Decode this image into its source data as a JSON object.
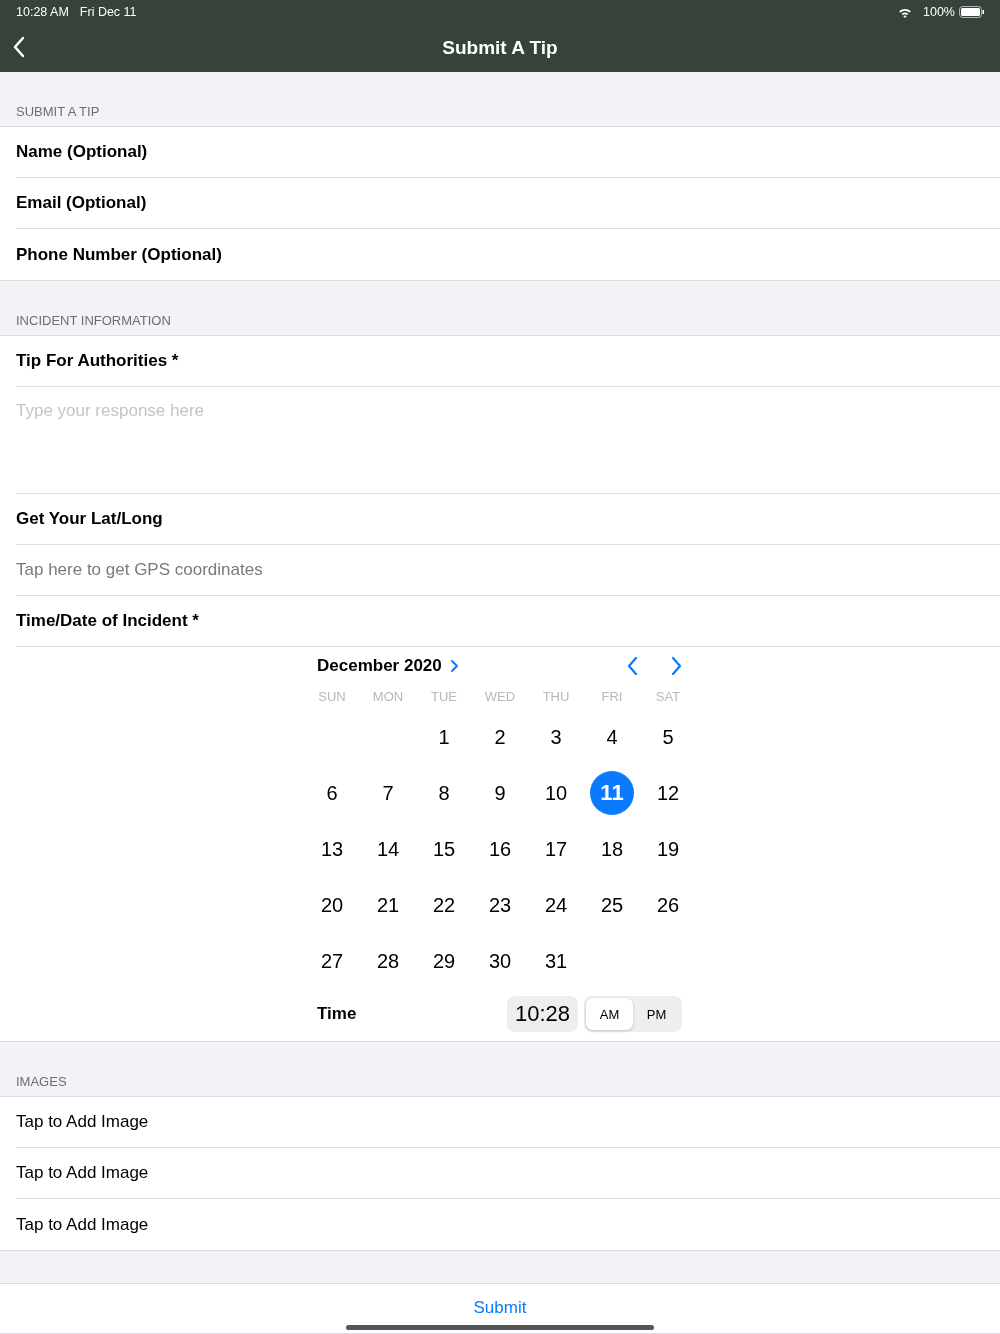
{
  "status_bar": {
    "time": "10:28 AM",
    "date": "Fri Dec 11",
    "battery": "100%"
  },
  "nav": {
    "title": "Submit A Tip"
  },
  "sections": [
    {
      "header": "SUBMIT A TIP",
      "items": [
        {
          "kind": "label",
          "text": "Name (Optional)"
        },
        {
          "kind": "label",
          "text": "Email (Optional)"
        },
        {
          "kind": "label",
          "text": "Phone Number (Optional)"
        }
      ]
    },
    {
      "header": "INCIDENT INFORMATION",
      "items": [
        {
          "kind": "label",
          "text": "Tip For Authorities *"
        },
        {
          "kind": "textarea",
          "placeholder": "Type your response here"
        },
        {
          "kind": "label",
          "text": "Get Your Lat/Long"
        },
        {
          "kind": "action",
          "text": "Tap here to get GPS coordinates"
        },
        {
          "kind": "label",
          "text": "Time/Date of Incident *"
        },
        {
          "kind": "datepicker",
          "month": "December 2020",
          "weekdays": [
            "SUN",
            "MON",
            "TUE",
            "WED",
            "THU",
            "FRI",
            "SAT"
          ],
          "weeks": [
            {
              "days": [
                {
                  "kind": "blank"
                },
                {
                  "kind": "blank"
                },
                {
                  "day": "1",
                  "selected": false
                },
                {
                  "day": "2",
                  "selected": false
                },
                {
                  "day": "3",
                  "selected": false
                },
                {
                  "day": "4",
                  "selected": false
                },
                {
                  "day": "5",
                  "selected": false
                }
              ]
            },
            {
              "days": [
                {
                  "day": "6",
                  "selected": false
                },
                {
                  "day": "7",
                  "selected": false
                },
                {
                  "day": "8",
                  "selected": false
                },
                {
                  "day": "9",
                  "selected": false
                },
                {
                  "day": "10",
                  "selected": false
                },
                {
                  "day": "11",
                  "selected": true
                },
                {
                  "day": "12",
                  "selected": false
                }
              ]
            },
            {
              "days": [
                {
                  "day": "13",
                  "selected": false
                },
                {
                  "day": "14",
                  "selected": false
                },
                {
                  "day": "15",
                  "selected": false
                },
                {
                  "day": "16",
                  "selected": false
                },
                {
                  "day": "17",
                  "selected": false
                },
                {
                  "day": "18",
                  "selected": false
                },
                {
                  "day": "19",
                  "selected": false
                }
              ]
            },
            {
              "days": [
                {
                  "day": "20",
                  "selected": false
                },
                {
                  "day": "21",
                  "selected": false
                },
                {
                  "day": "22",
                  "selected": false
                },
                {
                  "day": "23",
                  "selected": false
                },
                {
                  "day": "24",
                  "selected": false
                },
                {
                  "day": "25",
                  "selected": false
                },
                {
                  "day": "26",
                  "selected": false
                }
              ]
            },
            {
              "days": [
                {
                  "day": "27",
                  "selected": false
                },
                {
                  "day": "28",
                  "selected": false
                },
                {
                  "day": "29",
                  "selected": false
                },
                {
                  "day": "30",
                  "selected": false
                },
                {
                  "day": "31",
                  "selected": false
                }
              ]
            }
          ],
          "time_label": "Time",
          "time": "10:28",
          "periods": [
            {
              "label": "AM",
              "selected": true
            },
            {
              "label": "PM",
              "selected": false
            }
          ]
        }
      ]
    },
    {
      "header": "IMAGES",
      "items": [
        {
          "kind": "action_dark",
          "text": "Tap to Add Image"
        },
        {
          "kind": "action_dark",
          "text": "Tap to Add Image"
        },
        {
          "kind": "action_dark",
          "text": "Tap to Add Image"
        }
      ]
    }
  ],
  "submit": "Submit"
}
